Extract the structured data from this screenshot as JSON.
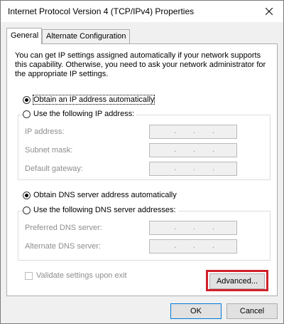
{
  "window": {
    "title": "Internet Protocol Version 4 (TCP/IPv4) Properties"
  },
  "tabs": [
    {
      "label": "General",
      "selected": true
    },
    {
      "label": "Alternate Configuration",
      "selected": false
    }
  ],
  "description": "You can get IP settings assigned automatically if your network supports this capability. Otherwise, you need to ask your network administrator for the appropriate IP settings.",
  "ip_section": {
    "auto_option": {
      "label": "Obtain an IP address automatically",
      "checked": true
    },
    "manual_option": {
      "label": "Use the following IP address:",
      "checked": false
    },
    "fields": [
      {
        "label": "IP address:",
        "value": ".   .   ."
      },
      {
        "label": "Subnet mask:",
        "value": ".   .   ."
      },
      {
        "label": "Default gateway:",
        "value": ".   .   ."
      }
    ]
  },
  "dns_section": {
    "auto_option": {
      "label": "Obtain DNS server address automatically",
      "checked": true
    },
    "manual_option": {
      "label": "Use the following DNS server addresses:",
      "checked": false
    },
    "fields": [
      {
        "label": "Preferred DNS server:",
        "value": ".   .   ."
      },
      {
        "label": "Alternate DNS server:",
        "value": ".   .   ."
      }
    ]
  },
  "validate": {
    "label": "Validate settings upon exit",
    "checked": false
  },
  "buttons": {
    "advanced": "Advanced...",
    "ok": "OK",
    "cancel": "Cancel"
  },
  "colors": {
    "highlight": "#d0202a",
    "ok_border": "#0078d7"
  }
}
